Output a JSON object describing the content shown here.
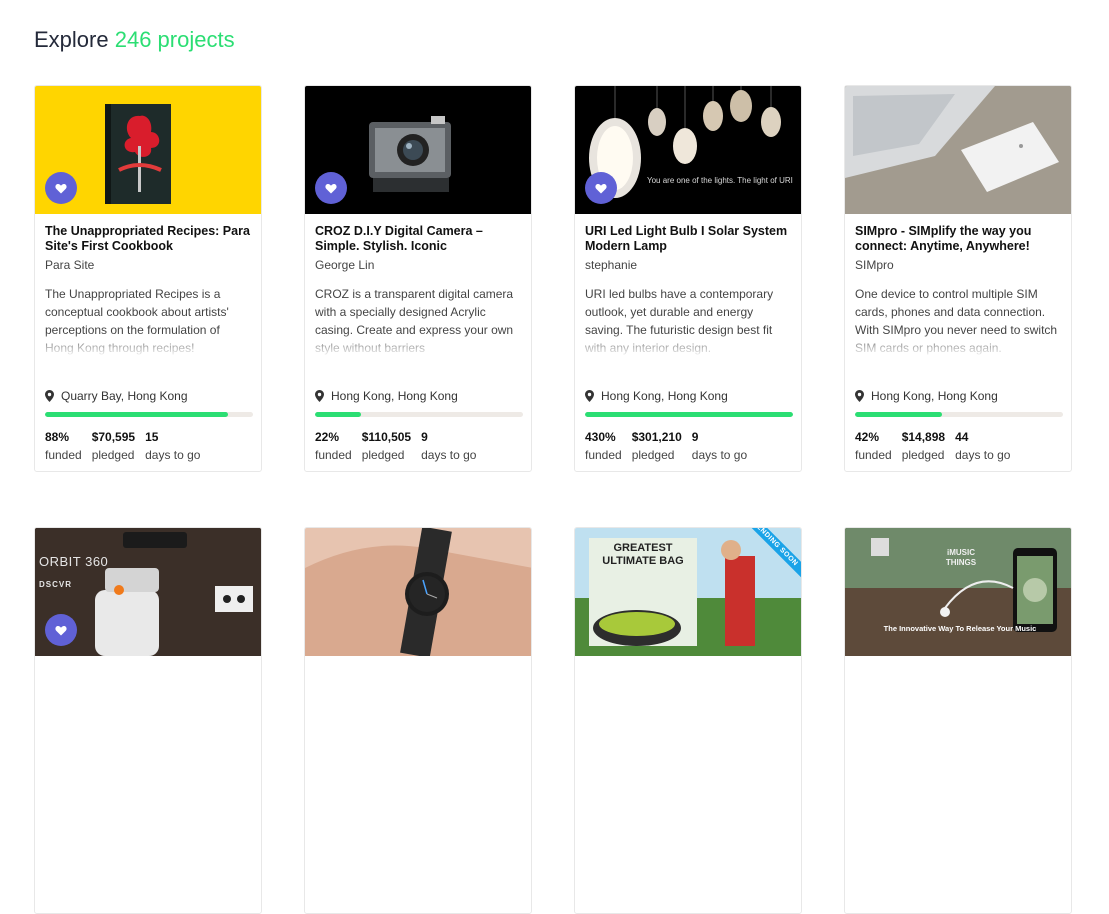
{
  "header": {
    "prefix": "Explore",
    "count_text": "246 projects"
  },
  "cards": [
    {
      "title": "The Unappropriated Recipes: Para Site's First Cookbook",
      "owner": "Para Site",
      "description": "The Unappropriated Recipes is a conceptual cookbook about artists' perceptions on the formulation of Hong Kong through recipes!",
      "location": "Quarry Bay, Hong Kong",
      "funded_value": "88%",
      "funded_label": "funded",
      "pledged_value": "$70,595",
      "pledged_label": "pledged",
      "days_value": "15",
      "days_label": "days to go",
      "progress": 0.88
    },
    {
      "title": "CROZ D.I.Y Digital Camera – Simple. Stylish. Iconic",
      "owner": "George Lin",
      "description": "CROZ is a transparent digital camera with a specially designed Acrylic casing. Create and express your own style without barriers",
      "location": "Hong Kong, Hong Kong",
      "funded_value": "22%",
      "funded_label": "funded",
      "pledged_value": "$110,505",
      "pledged_label": "pledged",
      "days_value": "9",
      "days_label": "days to go",
      "progress": 0.22
    },
    {
      "title": "URI Led Light Bulb I Solar System Modern Lamp",
      "owner": "stephanie",
      "description": "URI led bulbs have a contemporary outlook, yet durable and energy saving. The futuristic design best fit with any interior design.",
      "location": "Hong Kong, Hong Kong",
      "funded_value": "430%",
      "funded_label": "funded",
      "pledged_value": "$301,210",
      "pledged_label": "pledged",
      "days_value": "9",
      "days_label": "days to go",
      "progress": 1.0,
      "image_caption": "You are one of the lights. The light of URI"
    },
    {
      "title": "SIMpro - SIMplify the way you connect: Anytime, Anywhere!",
      "owner": "SIMpro",
      "description": "One device to control multiple SIM cards, phones and data connection. With SIMpro you never need to switch SIM cards or phones again.",
      "location": "Hong Kong, Hong Kong",
      "funded_value": "42%",
      "funded_label": "funded",
      "pledged_value": "$14,898",
      "pledged_label": "pledged",
      "days_value": "44",
      "days_label": "days to go",
      "progress": 0.42
    }
  ],
  "row2": {
    "orbit_text": "ORBIT 360",
    "orbit_brand": "DSCVR",
    "bag_text": "GREATEST ULTIMATE BAG",
    "ribbon_text": "ENDING SOON",
    "music_brand": "iMUSIC THINGS",
    "music_tagline": "The Innovative Way To Release Your Music"
  },
  "colors": {
    "accent": "#2bde73",
    "heart": "#6061d6",
    "ribbon": "#1aa3e8"
  }
}
